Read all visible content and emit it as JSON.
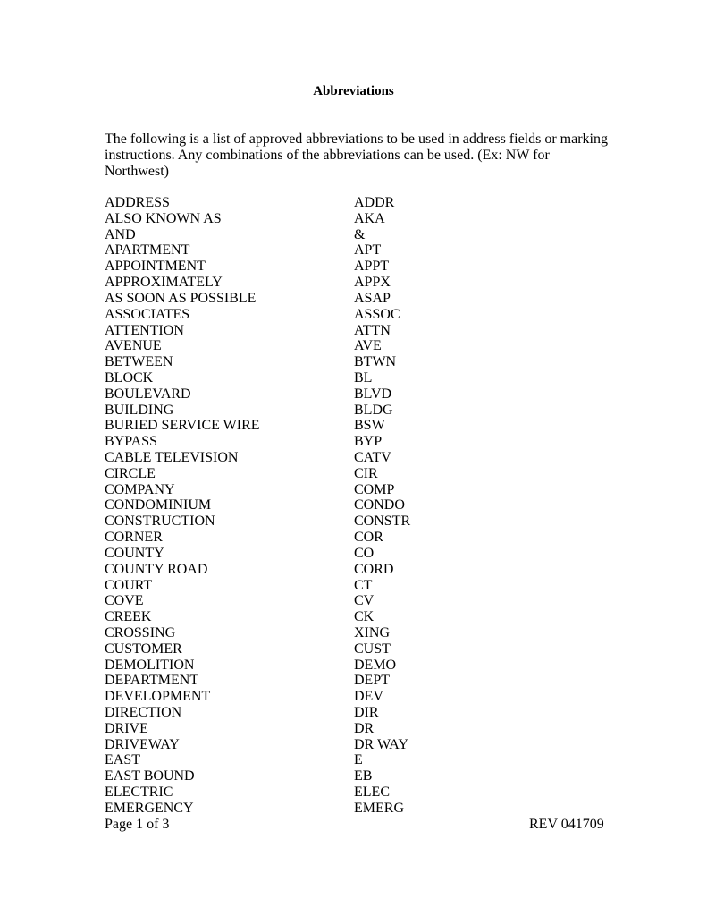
{
  "title": "Abbreviations",
  "intro": "The following is a list of approved abbreviations to be used in address fields or marking instructions. Any combinations of the abbreviations can be used. (Ex: NW for Northwest)",
  "rows": [
    [
      "ADDRESS",
      "ADDR"
    ],
    [
      "ALSO KNOWN AS",
      "AKA"
    ],
    [
      "AND",
      "&"
    ],
    [
      "APARTMENT",
      "APT"
    ],
    [
      "APPOINTMENT",
      "APPT"
    ],
    [
      "APPROXIMATELY",
      "APPX"
    ],
    [
      "AS SOON AS POSSIBLE",
      "ASAP"
    ],
    [
      "ASSOCIATES",
      "ASSOC"
    ],
    [
      "ATTENTION",
      "ATTN"
    ],
    [
      "AVENUE",
      "AVE"
    ],
    [
      "BETWEEN",
      "BTWN"
    ],
    [
      "BLOCK",
      "BL"
    ],
    [
      "BOULEVARD",
      "BLVD"
    ],
    [
      "BUILDING",
      "BLDG"
    ],
    [
      "BURIED SERVICE WIRE",
      "BSW"
    ],
    [
      "BYPASS",
      "BYP"
    ],
    [
      "CABLE TELEVISION",
      "CATV"
    ],
    [
      "CIRCLE",
      "CIR"
    ],
    [
      "COMPANY",
      "COMP"
    ],
    [
      "CONDOMINIUM",
      "CONDO"
    ],
    [
      "CONSTRUCTION",
      "CONSTR"
    ],
    [
      "CORNER",
      "COR"
    ],
    [
      "COUNTY",
      "CO"
    ],
    [
      "COUNTY ROAD",
      "CORD"
    ],
    [
      "COURT",
      "CT"
    ],
    [
      "COVE",
      "CV"
    ],
    [
      "CREEK",
      "CK"
    ],
    [
      "CROSSING",
      "XING"
    ],
    [
      "CUSTOMER",
      "CUST"
    ],
    [
      "DEMOLITION",
      "DEMO"
    ],
    [
      "DEPARTMENT",
      "DEPT"
    ],
    [
      "DEVELOPMENT",
      "DEV"
    ],
    [
      "DIRECTION",
      "DIR"
    ],
    [
      "DRIVE",
      "DR"
    ],
    [
      "DRIVEWAY",
      "DR WAY"
    ],
    [
      "EAST",
      "E"
    ],
    [
      "EAST BOUND",
      "EB"
    ],
    [
      "ELECTRIC",
      "ELEC"
    ],
    [
      "EMERGENCY",
      "EMERG"
    ]
  ],
  "footer": {
    "page": "Page 1 of 3",
    "revision": "REV 041709"
  }
}
